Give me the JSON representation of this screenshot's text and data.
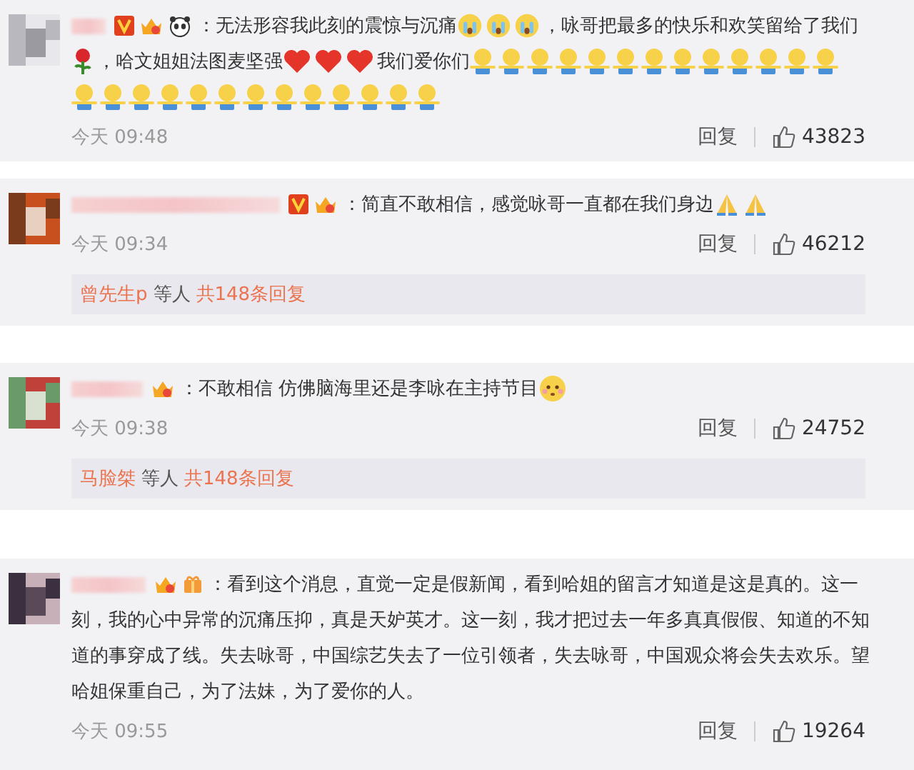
{
  "comments": [
    {
      "badges": [
        {
          "kind": "v"
        },
        {
          "kind": "crown"
        },
        {
          "kind": "panda"
        }
      ],
      "parts": [
        {
          "kind": "text",
          "text": "：无法形容我此刻的震惊与沉痛"
        },
        {
          "kind": "crying"
        },
        {
          "kind": "crying"
        },
        {
          "kind": "crying"
        },
        {
          "kind": "text",
          "text": "，咏哥把最多的快乐和欢笑留给了我们"
        },
        {
          "kind": "rose"
        },
        {
          "kind": "text",
          "text": "，哈文姐姐法图麦坚强"
        },
        {
          "kind": "heart"
        },
        {
          "kind": "heart"
        },
        {
          "kind": "heart"
        },
        {
          "kind": "text",
          "text": "我们爱你们"
        },
        {
          "kind": "hug"
        },
        {
          "kind": "hug"
        },
        {
          "kind": "hug"
        },
        {
          "kind": "hug"
        },
        {
          "kind": "hug"
        },
        {
          "kind": "hug"
        },
        {
          "kind": "hug"
        },
        {
          "kind": "hug"
        },
        {
          "kind": "hug"
        },
        {
          "kind": "hug"
        },
        {
          "kind": "hug"
        },
        {
          "kind": "hug"
        },
        {
          "kind": "hug"
        },
        {
          "kind": "hug"
        },
        {
          "kind": "hug"
        },
        {
          "kind": "hug"
        },
        {
          "kind": "hug"
        },
        {
          "kind": "hug"
        },
        {
          "kind": "hug"
        },
        {
          "kind": "hug"
        },
        {
          "kind": "hug"
        },
        {
          "kind": "hug"
        },
        {
          "kind": "hug"
        },
        {
          "kind": "hug"
        },
        {
          "kind": "hug"
        },
        {
          "kind": "hug"
        }
      ],
      "time": "今天 09:48",
      "reply": "回复",
      "likes": "43823"
    },
    {
      "badges": [
        {
          "kind": "v"
        },
        {
          "kind": "crown"
        }
      ],
      "parts": [
        {
          "kind": "text",
          "text": "：简直不敢相信，感觉咏哥一直都在我们身边"
        },
        {
          "kind": "pray"
        },
        {
          "kind": "pray"
        }
      ],
      "time": "今天 09:34",
      "reply": "回复",
      "likes": "46212",
      "replies": {
        "name": "曾先生p",
        "joiner": "等人",
        "total": "共148条回复"
      }
    },
    {
      "badges": [
        {
          "kind": "crown"
        }
      ],
      "parts": [
        {
          "kind": "text",
          "text": "：不敢相信 仿佛脑海里还是李咏在主持节目"
        },
        {
          "kind": "blush"
        }
      ],
      "time": "今天 09:38",
      "reply": "回复",
      "likes": "24752",
      "replies": {
        "name": "马脸桀",
        "joiner": "等人",
        "total": "共148条回复"
      }
    },
    {
      "badges": [
        {
          "kind": "crown"
        },
        {
          "kind": "gift"
        }
      ],
      "parts": [
        {
          "kind": "text",
          "text": "：看到这个消息，直觉一定是假新闻，看到哈姐的留言才知道是这是真的。这一"
        },
        {
          "kind": "line",
          "text": "刻，我的心中异常的沉痛压抑，真是天妒英才。这一刻，我才把过去一年多真真假假、知道的不知道的事穿成了线。失去咏哥，中国综艺失去了一位引领者，失去咏哥，中国观众将会失去欢乐。望哈姐保重自己，为了法妹，为了爱你的人。"
        }
      ],
      "time": "今天 09:55",
      "reply": "回复",
      "likes": "19264"
    }
  ]
}
